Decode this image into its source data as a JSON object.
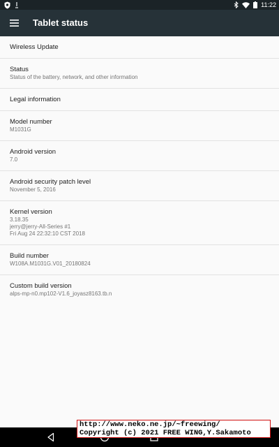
{
  "status_bar": {
    "time": "11:22",
    "icons": [
      "shield-icon",
      "notification-icon",
      "bluetooth-icon",
      "wifi-icon",
      "battery-icon"
    ]
  },
  "toolbar": {
    "title": "Tablet status",
    "menu_icon": "hamburger-menu-icon"
  },
  "items": [
    {
      "title": "Wireless Update",
      "subtitle": ""
    },
    {
      "title": "Status",
      "subtitle": "Status of the battery, network, and other information"
    },
    {
      "title": "Legal information",
      "subtitle": ""
    },
    {
      "title": "Model number",
      "subtitle": "M1031G"
    },
    {
      "title": "Android version",
      "subtitle": "7.0"
    },
    {
      "title": "Android security patch level",
      "subtitle": "November 5, 2016"
    },
    {
      "title": "Kernel version",
      "subtitle_lines": [
        "3.18.35",
        "jerry@jerry-All-Series #1",
        "Fri Aug 24 22:32:10 CST 2018"
      ]
    },
    {
      "title": "Build number",
      "subtitle": "W108A.M1031G.V01_20180824"
    },
    {
      "title": "Custom build version",
      "subtitle": "alps-mp-n0.mp102-V1.6_joyasz8163.tb.n"
    }
  ],
  "nav_bar": {
    "buttons": [
      "back-icon",
      "home-icon",
      "recents-icon"
    ]
  },
  "watermark": {
    "line1": "http://www.neko.ne.jp/~freewing/",
    "line2": "Copyright (c) 2021 FREE WING,Y.Sakamoto"
  }
}
